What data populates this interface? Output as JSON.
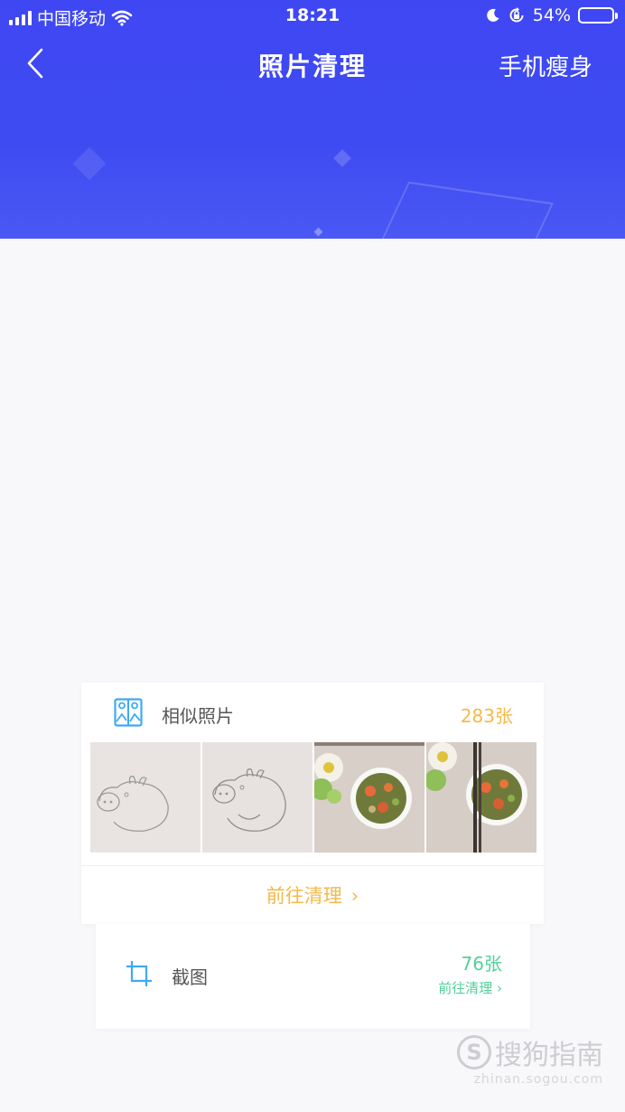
{
  "status_bar": {
    "carrier": "中国移动",
    "time": "18:21",
    "battery": "54%",
    "battery_level": 0.54,
    "icons": [
      "signal-icon",
      "wifi-icon",
      "moon-icon",
      "rotation-lock-icon",
      "battery-icon"
    ]
  },
  "nav": {
    "back_icon": "chevron-left-icon",
    "title": "照片清理",
    "right_action": "手机瘦身"
  },
  "colors": {
    "header": "#3f47f3",
    "accent_orange": "#f5b94a",
    "accent_green": "#52d09a",
    "background": "#f8f8fa"
  },
  "similar_photos": {
    "icon": "similar-photos-icon",
    "label": "相似照片",
    "count": "283张",
    "thumbnails": [
      "pig-sketch-1",
      "pig-sketch-2",
      "food-bowl-flower-1",
      "food-bowl-flower-2"
    ],
    "action": "前往清理",
    "action_icon": "chevron-right-icon"
  },
  "screenshots": {
    "icon": "crop-icon",
    "label": "截图",
    "count": "76张",
    "action": "前往清理",
    "action_icon": "chevron-right-icon"
  },
  "watermark": {
    "brand": "搜狗指南",
    "url": "zhinan.sogou.com"
  }
}
